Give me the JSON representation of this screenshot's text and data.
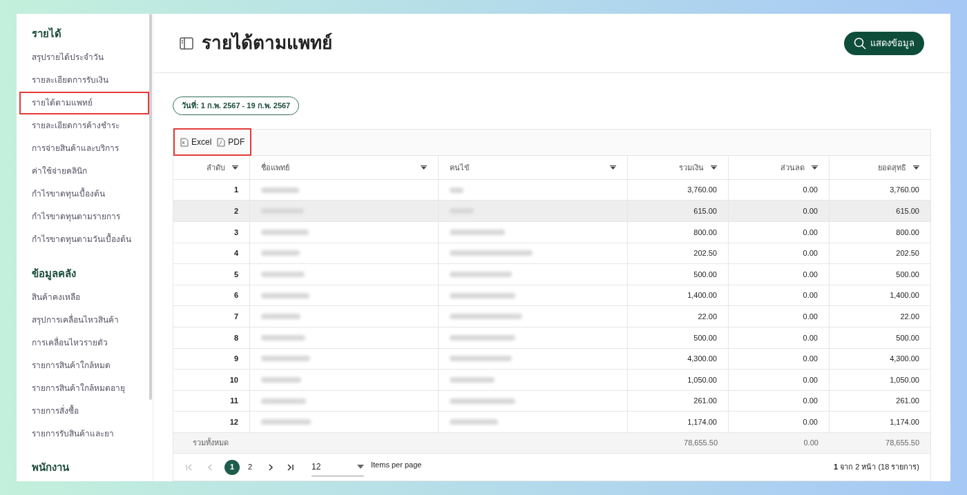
{
  "sidebar": {
    "sections": [
      {
        "title": "รายได้",
        "items": [
          {
            "label": "สรุปรายได้ประจำวัน",
            "highlighted": false
          },
          {
            "label": "รายละเอียดการรับเงิน",
            "highlighted": false
          },
          {
            "label": "รายได้ตามแพทย์",
            "highlighted": true
          },
          {
            "label": "รายละเอียดการค้างชำระ",
            "highlighted": false
          },
          {
            "label": "การจ่ายสินค้าและบริการ",
            "highlighted": false
          },
          {
            "label": "ค่าใช้จ่ายคลินิก",
            "highlighted": false
          },
          {
            "label": "กำไรขาดทุนเบื้องต้น",
            "highlighted": false
          },
          {
            "label": "กำไรขาดทุนตามรายการ",
            "highlighted": false
          },
          {
            "label": "กำไรขาดทุนตามวันเบื้องต้น",
            "highlighted": false
          }
        ]
      },
      {
        "title": "ข้อมูลคลัง",
        "items": [
          {
            "label": "สินค้าคงเหลือ",
            "highlighted": false
          },
          {
            "label": "สรุปการเคลื่อนไหวสินค้า",
            "highlighted": false
          },
          {
            "label": "การเคลื่อนไหวรายตัว",
            "highlighted": false
          },
          {
            "label": "รายการสินค้าใกล้หมด",
            "highlighted": false
          },
          {
            "label": "รายการสินค้าใกล้หมดอายุ",
            "highlighted": false
          },
          {
            "label": "รายการสั่งซื้อ",
            "highlighted": false
          },
          {
            "label": "รายการรับสินค้าและยา",
            "highlighted": false
          }
        ]
      },
      {
        "title": "พนักงาน"
      }
    ]
  },
  "header": {
    "title": "รายได้ตามแพทย์",
    "button": "แสดงข้อมูล"
  },
  "date_chip": "วันที่: 1 ก.พ. 2567 - 19 ก.พ. 2567",
  "toolbar": {
    "highlighted": true,
    "buttons": [
      {
        "label": "Excel",
        "kind": "excel"
      },
      {
        "label": "PDF",
        "kind": "pdf"
      }
    ]
  },
  "table": {
    "columns": [
      "ลำดับ",
      "ชื่อแพทย์",
      "คนไข้",
      "รวมเงิน",
      "ส่วนลด",
      "ยอดสุทธิ"
    ],
    "rows": [
      {
        "no": "1",
        "total": "3,760.00",
        "discount": "0.00",
        "net": "3,760.00",
        "hovered": false
      },
      {
        "no": "2",
        "total": "615.00",
        "discount": "0.00",
        "net": "615.00",
        "hovered": true
      },
      {
        "no": "3",
        "total": "800.00",
        "discount": "0.00",
        "net": "800.00",
        "hovered": false
      },
      {
        "no": "4",
        "total": "202.50",
        "discount": "0.00",
        "net": "202.50",
        "hovered": false
      },
      {
        "no": "5",
        "total": "500.00",
        "discount": "0.00",
        "net": "500.00",
        "hovered": false
      },
      {
        "no": "6",
        "total": "1,400.00",
        "discount": "0.00",
        "net": "1,400.00",
        "hovered": false
      },
      {
        "no": "7",
        "total": "22.00",
        "discount": "0.00",
        "net": "22.00",
        "hovered": false
      },
      {
        "no": "8",
        "total": "500.00",
        "discount": "0.00",
        "net": "500.00",
        "hovered": false
      },
      {
        "no": "9",
        "total": "4,300.00",
        "discount": "0.00",
        "net": "4,300.00",
        "hovered": false
      },
      {
        "no": "10",
        "total": "1,050.00",
        "discount": "0.00",
        "net": "1,050.00",
        "hovered": false
      },
      {
        "no": "11",
        "total": "261.00",
        "discount": "0.00",
        "net": "261.00",
        "hovered": false
      },
      {
        "no": "12",
        "total": "1,174.00",
        "discount": "0.00",
        "net": "1,174.00",
        "hovered": false
      }
    ],
    "footer": {
      "label": "รวมทั้งหมด",
      "total": "78,655.50",
      "discount": "0.00",
      "net": "78,655.50"
    }
  },
  "pagination": {
    "pages": [
      {
        "label": "1",
        "selected": true
      },
      {
        "label": "2",
        "selected": false
      }
    ],
    "page_size": "12",
    "page_size_label": "Items per page",
    "summary_bold": "1",
    "summary": "จาก 2 หน้า (18 รายการ)"
  }
}
